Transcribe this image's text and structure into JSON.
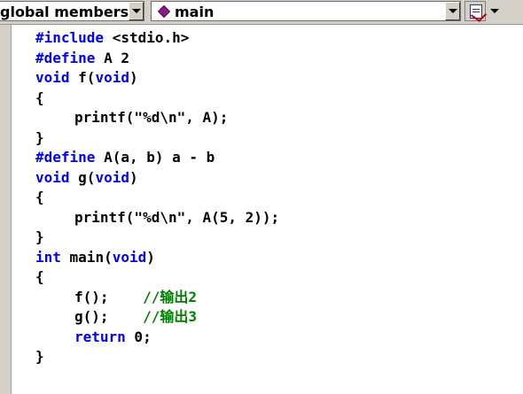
{
  "toolbar": {
    "scope_combo": {
      "value": "global members"
    },
    "function_combo": {
      "value": "main"
    },
    "icons": [
      "dropdown-arrow-icon",
      "member-function-diamond-icon",
      "wizard-bar-action-icon"
    ]
  },
  "editor": {
    "colors": {
      "keyword": "#0000ff",
      "comment": "#008000",
      "text": "#000000"
    },
    "lines": [
      {
        "indent": false,
        "tokens": [
          {
            "t": "#include",
            "c": "kw"
          },
          {
            "t": " <stdio.h>",
            "c": ""
          }
        ]
      },
      {
        "indent": false,
        "tokens": [
          {
            "t": "#define",
            "c": "kw"
          },
          {
            "t": " A 2",
            "c": ""
          }
        ]
      },
      {
        "indent": false,
        "tokens": [
          {
            "t": "void",
            "c": "kw"
          },
          {
            "t": " f(",
            "c": ""
          },
          {
            "t": "void",
            "c": "kw"
          },
          {
            "t": ")",
            "c": ""
          }
        ]
      },
      {
        "indent": false,
        "tokens": [
          {
            "t": "{",
            "c": ""
          }
        ]
      },
      {
        "indent": true,
        "tokens": [
          {
            "t": "printf(\"%d\\n\", A);",
            "c": ""
          }
        ]
      },
      {
        "indent": false,
        "tokens": [
          {
            "t": "}",
            "c": ""
          }
        ]
      },
      {
        "indent": false,
        "tokens": [
          {
            "t": "#define",
            "c": "kw"
          },
          {
            "t": " A(a, b) a - b",
            "c": ""
          }
        ]
      },
      {
        "indent": false,
        "tokens": [
          {
            "t": "void",
            "c": "kw"
          },
          {
            "t": " g(",
            "c": ""
          },
          {
            "t": "void",
            "c": "kw"
          },
          {
            "t": ")",
            "c": ""
          }
        ]
      },
      {
        "indent": false,
        "tokens": [
          {
            "t": "{",
            "c": ""
          }
        ]
      },
      {
        "indent": true,
        "tokens": [
          {
            "t": "printf(\"%d\\n\", A(5, 2));",
            "c": ""
          }
        ]
      },
      {
        "indent": false,
        "tokens": [
          {
            "t": "}",
            "c": ""
          }
        ]
      },
      {
        "indent": false,
        "tokens": [
          {
            "t": "int",
            "c": "kw"
          },
          {
            "t": " main(",
            "c": ""
          },
          {
            "t": "void",
            "c": "kw"
          },
          {
            "t": ")",
            "c": ""
          }
        ]
      },
      {
        "indent": false,
        "tokens": [
          {
            "t": "{",
            "c": ""
          }
        ]
      },
      {
        "indent": true,
        "tokens": [
          {
            "t": "f();    ",
            "c": ""
          },
          {
            "t": "//输出2",
            "c": "cm"
          }
        ]
      },
      {
        "indent": true,
        "tokens": [
          {
            "t": "g();    ",
            "c": ""
          },
          {
            "t": "//输出3",
            "c": "cm"
          }
        ]
      },
      {
        "indent": true,
        "tokens": [
          {
            "t": "return",
            "c": "kw"
          },
          {
            "t": " 0;",
            "c": ""
          }
        ]
      },
      {
        "indent": false,
        "tokens": [
          {
            "t": "}",
            "c": ""
          }
        ]
      }
    ]
  }
}
